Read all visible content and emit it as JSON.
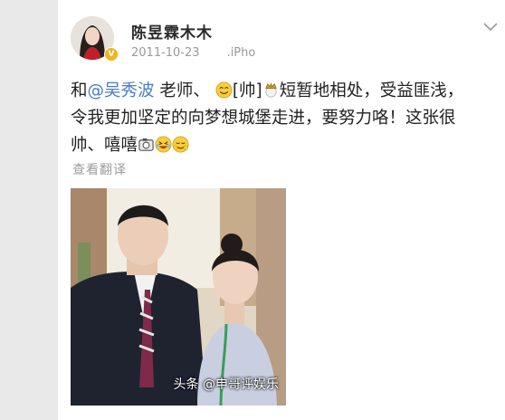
{
  "user": {
    "name": "陈昱霖木木",
    "date": "2011-10-23",
    "source": ".iPho"
  },
  "post": {
    "p1": "和",
    "mention": "@吴秀波",
    "p2": " 老师、",
    "p3": "[帅]",
    "p4": "短暂地相处，受益匪浅，",
    "line2": "令我更加坚定的向梦想城堡走进，要努力咯！这张很",
    "line3": "帅、嘻嘻"
  },
  "translate_label": "查看翻译",
  "watermark": "头条 @申哥评娱乐",
  "colors": {
    "mention": "#4a7cc6",
    "badge": "#f2b41d",
    "meta": "#9a9a9a"
  },
  "icons": [
    "chevron-down-icon",
    "smile-emoji-icon",
    "crown-emoji-icon",
    "camera-emoji-icon",
    "laugh-emoji-icon"
  ]
}
